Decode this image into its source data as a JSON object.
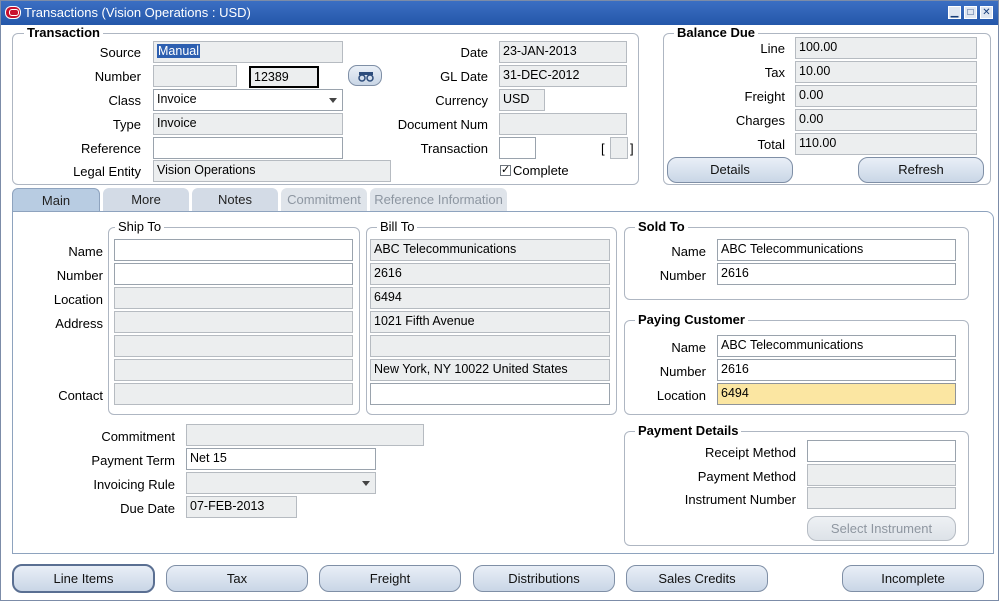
{
  "window": {
    "title": "Transactions (Vision Operations : USD)"
  },
  "transaction": {
    "legend": "Transaction",
    "source_label": "Source",
    "source_value": "Manual",
    "number_label": "Number",
    "number_value": "12389",
    "class_label": "Class",
    "class_value": "Invoice",
    "type_label": "Type",
    "type_value": "Invoice",
    "reference_label": "Reference",
    "reference_value": "",
    "legal_entity_label": "Legal Entity",
    "legal_entity_value": "Vision Operations",
    "date_label": "Date",
    "date_value": "23-JAN-2013",
    "gl_date_label": "GL Date",
    "gl_date_value": "31-DEC-2012",
    "currency_label": "Currency",
    "currency_value": "USD",
    "document_num_label": "Document Num",
    "document_num_value": "",
    "transaction_label": "Transaction",
    "transaction_value": "",
    "bracket_open": "[",
    "bracket_close": "]",
    "complete_label": "Complete",
    "complete_checked": "✓"
  },
  "balance_due": {
    "legend": "Balance Due",
    "line_label": "Line",
    "line_value": "100.00",
    "tax_label": "Tax",
    "tax_value": "10.00",
    "freight_label": "Freight",
    "freight_value": "0.00",
    "charges_label": "Charges",
    "charges_value": "0.00",
    "total_label": "Total",
    "total_value": "110.00",
    "details_label": "Details",
    "refresh_label": "Refresh"
  },
  "tabs": [
    {
      "label": "Main",
      "state": "active"
    },
    {
      "label": "More",
      "state": "enabled"
    },
    {
      "label": "Notes",
      "state": "enabled"
    },
    {
      "label": "Commitment",
      "state": "disabled"
    },
    {
      "label": "Reference Information",
      "state": "disabled"
    }
  ],
  "ship_to": {
    "legend": "Ship To",
    "name_label": "Name",
    "number_label": "Number",
    "location_label": "Location",
    "address_label": "Address",
    "contact_label": "Contact"
  },
  "bill_to": {
    "legend": "Bill To",
    "name": "ABC Telecommunications",
    "number": "2616",
    "location": "6494",
    "address1": "1021 Fifth Avenue",
    "address2": "",
    "address3": "New York, NY 10022 United States",
    "contact": ""
  },
  "sold_to": {
    "legend": "Sold To",
    "name_label": "Name",
    "name_value": "ABC Telecommunications",
    "number_label": "Number",
    "number_value": "2616"
  },
  "paying_customer": {
    "legend": "Paying Customer",
    "name_label": "Name",
    "name_value": "ABC Telecommunications",
    "number_label": "Number",
    "number_value": "2616",
    "location_label": "Location",
    "location_value": "6494"
  },
  "terms": {
    "commitment_label": "Commitment",
    "commitment_value": "",
    "payment_term_label": "Payment Term",
    "payment_term_value": "Net 15",
    "invoicing_rule_label": "Invoicing Rule",
    "invoicing_rule_value": "",
    "due_date_label": "Due Date",
    "due_date_value": "07-FEB-2013"
  },
  "payment_details": {
    "legend": "Payment Details",
    "receipt_method_label": "Receipt Method",
    "receipt_method_value": "",
    "payment_method_label": "Payment Method",
    "payment_method_value": "",
    "instrument_number_label": "Instrument Number",
    "instrument_number_value": "",
    "select_instrument_label": "Select Instrument"
  },
  "footer": {
    "line_items": "Line Items",
    "tax": "Tax",
    "freight": "Freight",
    "distributions": "Distributions",
    "sales_credits": "Sales Credits",
    "incomplete": "Incomplete"
  }
}
